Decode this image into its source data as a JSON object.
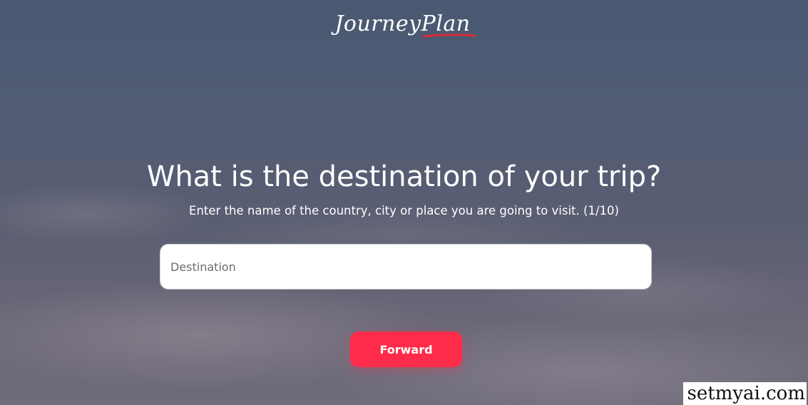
{
  "header": {
    "logo_text": "JourneyPlan",
    "accent_color": "#d92b3a"
  },
  "main": {
    "title": "What is the destination of your trip?",
    "subtitle": "Enter the name of the country, city or place you are going to visit. (1/10)",
    "destination_input": {
      "placeholder": "Destination",
      "value": ""
    },
    "forward_button_label": "Forward",
    "button_color": "#ff2b4a"
  },
  "watermark": {
    "text": "setmyai.com"
  }
}
